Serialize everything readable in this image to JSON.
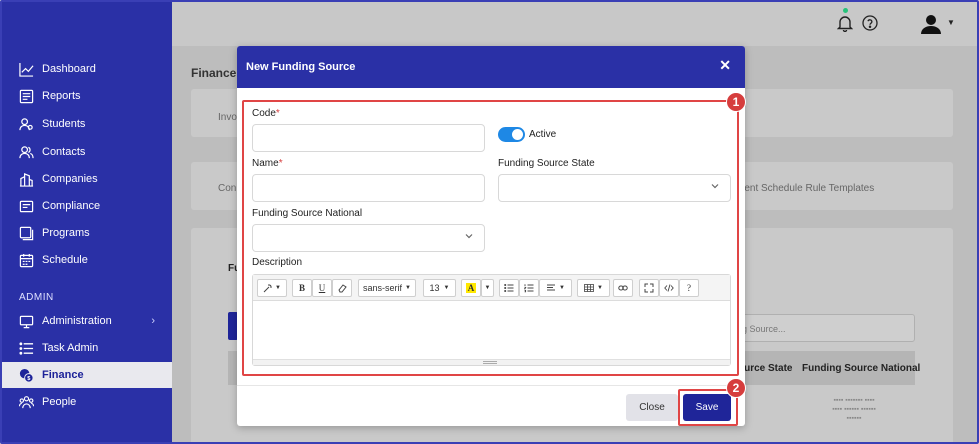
{
  "sidebar": {
    "items": [
      {
        "label": "Dashboard",
        "icon": "chart-line-icon"
      },
      {
        "label": "Reports",
        "icon": "report-icon"
      },
      {
        "label": "Students",
        "icon": "students-icon"
      },
      {
        "label": "Contacts",
        "icon": "contacts-icon"
      },
      {
        "label": "Companies",
        "icon": "companies-icon"
      },
      {
        "label": "Compliance",
        "icon": "compliance-icon"
      },
      {
        "label": "Programs",
        "icon": "programs-icon"
      },
      {
        "label": "Schedule",
        "icon": "calendar-icon"
      }
    ],
    "admin_section": "ADMIN",
    "admin_items": [
      {
        "label": "Administration",
        "icon": "monitor-icon"
      },
      {
        "label": "Task Admin",
        "icon": "list-icon"
      },
      {
        "label": "Finance",
        "icon": "finance-icon",
        "active": true
      },
      {
        "label": "People",
        "icon": "people-icon"
      }
    ],
    "chevron": "›"
  },
  "background_page": {
    "title": "Finance",
    "tab_partial_1": "Invo",
    "tab_partial_2": "Con",
    "tab_partial_3": "ment Schedule Rule Templates",
    "section_partial": "Fu",
    "search_placeholder": "ng Source...",
    "col_state": "ource State",
    "col_national": "Funding Source National"
  },
  "modal": {
    "title": "New Funding Source",
    "close_glyph": "✕",
    "fields": {
      "code_label": "Code",
      "required_mark": "*",
      "active_label": "Active",
      "name_label": "Name",
      "state_label": "Funding Source State",
      "national_label": "Funding Source National",
      "description_label": "Description"
    },
    "editor": {
      "font_family": "sans-serif",
      "font_size": "13",
      "help": "?"
    },
    "buttons": {
      "close": "Close",
      "save": "Save"
    }
  },
  "annotations": {
    "step1": "1",
    "step2": "2"
  },
  "colors": {
    "brand": "#2a30a6",
    "primary_button": "#1f2599",
    "toggle": "#1e88e5",
    "annotation": "#d63d3d"
  }
}
